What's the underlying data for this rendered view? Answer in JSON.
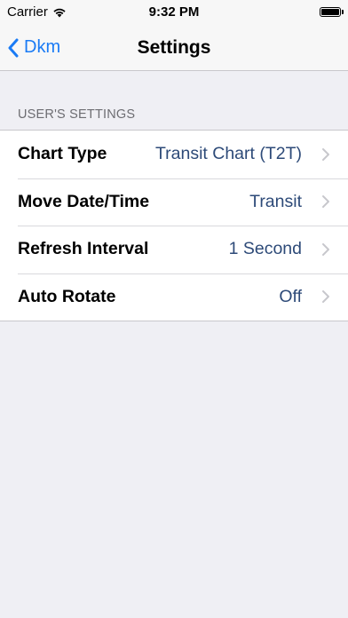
{
  "status_bar": {
    "carrier": "Carrier",
    "time": "9:32 PM",
    "wifi_icon": "wifi-icon",
    "battery_icon": "battery-icon"
  },
  "nav": {
    "back_label": "Dkm",
    "title": "Settings",
    "tint_color": "#1a7bf5"
  },
  "section": {
    "header": "USER'S SETTINGS"
  },
  "settings": [
    {
      "label": "Chart Type",
      "value": "Transit Chart (T2T)"
    },
    {
      "label": "Move Date/Time",
      "value": "Transit"
    },
    {
      "label": "Refresh Interval",
      "value": "1 Second"
    },
    {
      "label": "Auto Rotate",
      "value": "Off"
    }
  ],
  "colors": {
    "background": "#efeff4",
    "value_text": "#2d4a78",
    "chevron": "#c7c7cc"
  }
}
